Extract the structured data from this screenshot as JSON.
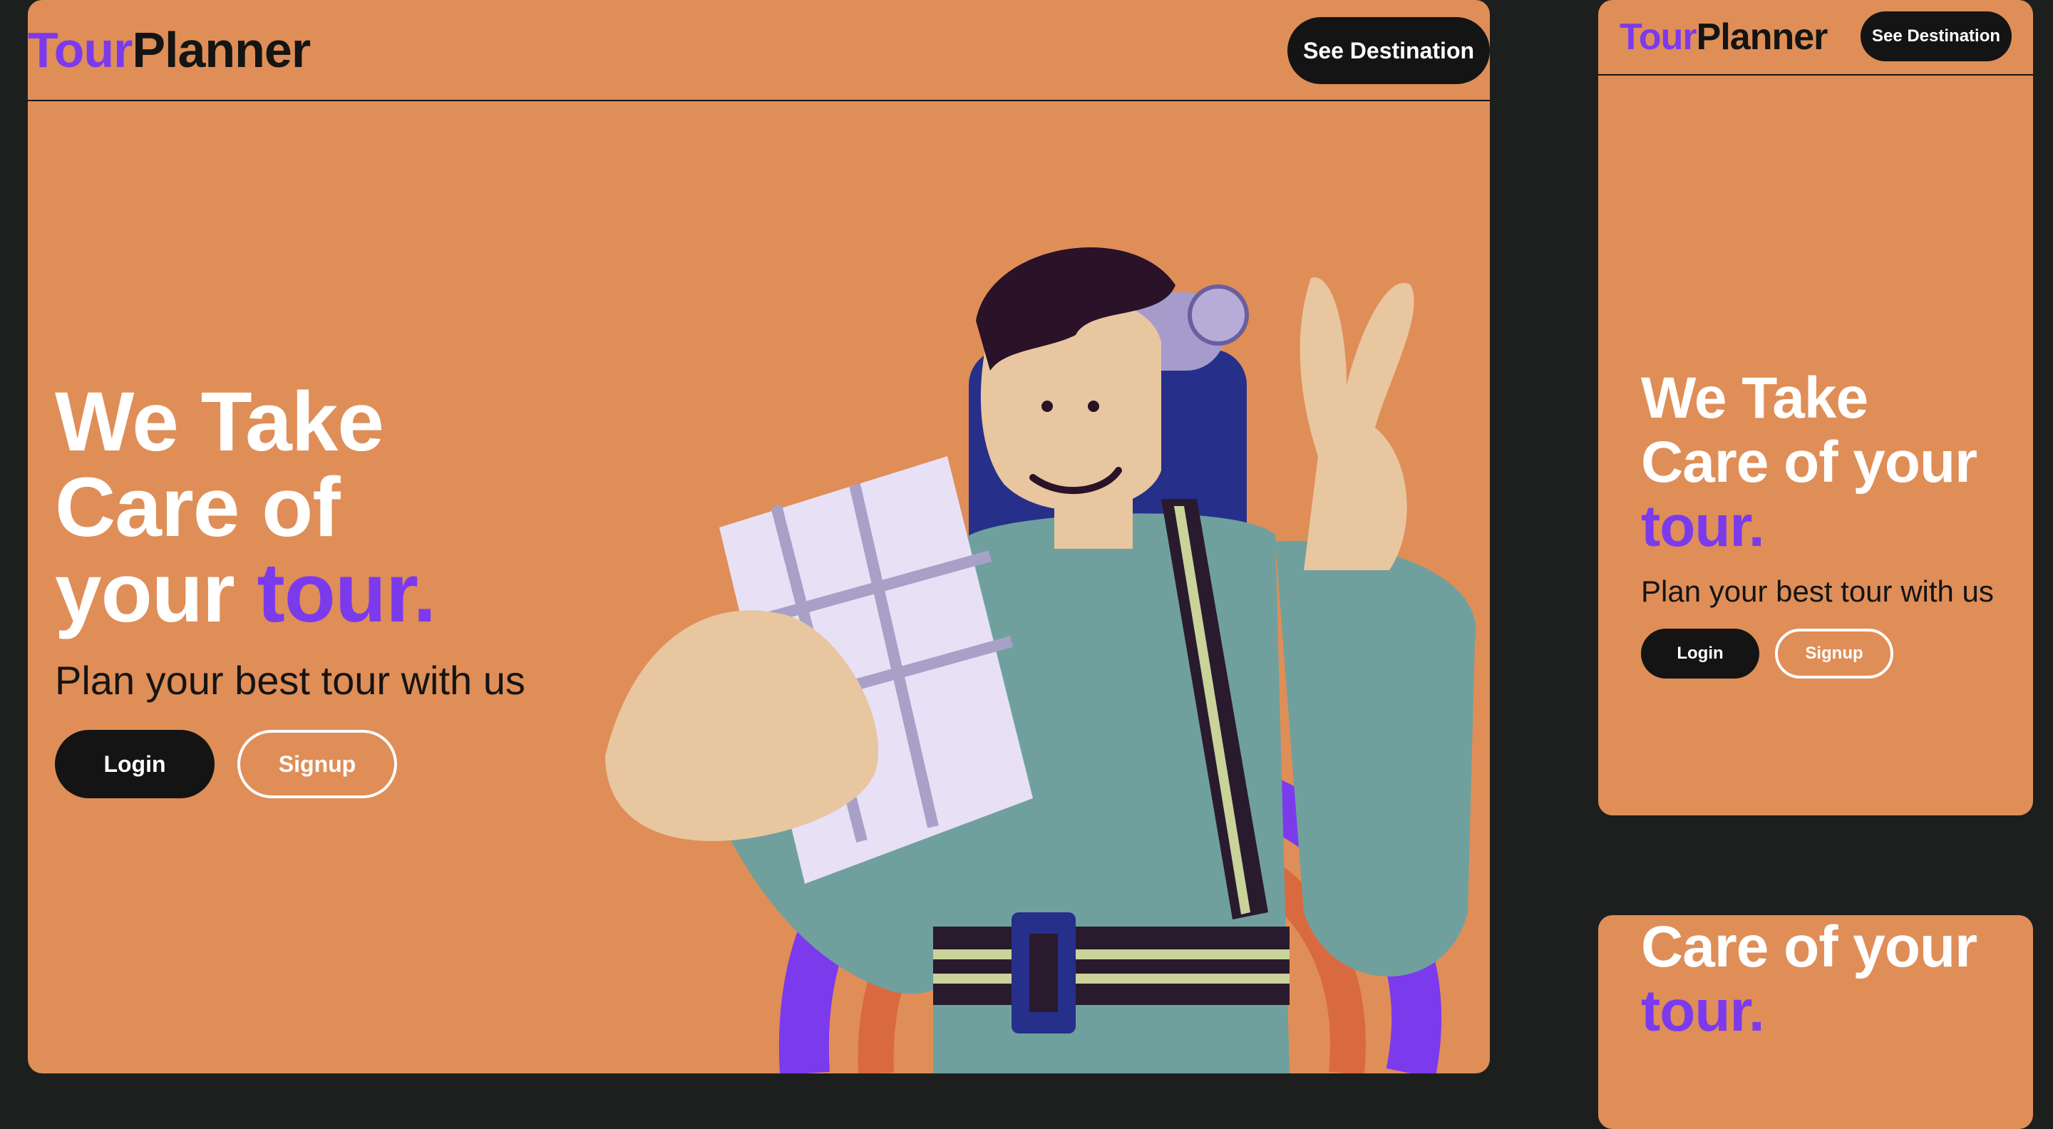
{
  "brand": {
    "part1": "Tour",
    "part2": "Planner"
  },
  "nav": {
    "cta_label": "See Destination"
  },
  "hero": {
    "title_line1": "We Take",
    "title_line2": "Care of",
    "title_line3_prefix": "your",
    "title_accent": "tour.",
    "mobile_title_line1": "We Take",
    "mobile_title_line2": "Care of your",
    "subtitle": "Plan your best tour with us"
  },
  "buttons": {
    "login": "Login",
    "signup": "Signup"
  },
  "colors": {
    "accent": "#7c3aed",
    "card_bg": "#df8e58",
    "page_bg": "#1c1f1e",
    "dark": "#141414"
  },
  "illustration": {
    "icon": "traveler-illustration"
  }
}
